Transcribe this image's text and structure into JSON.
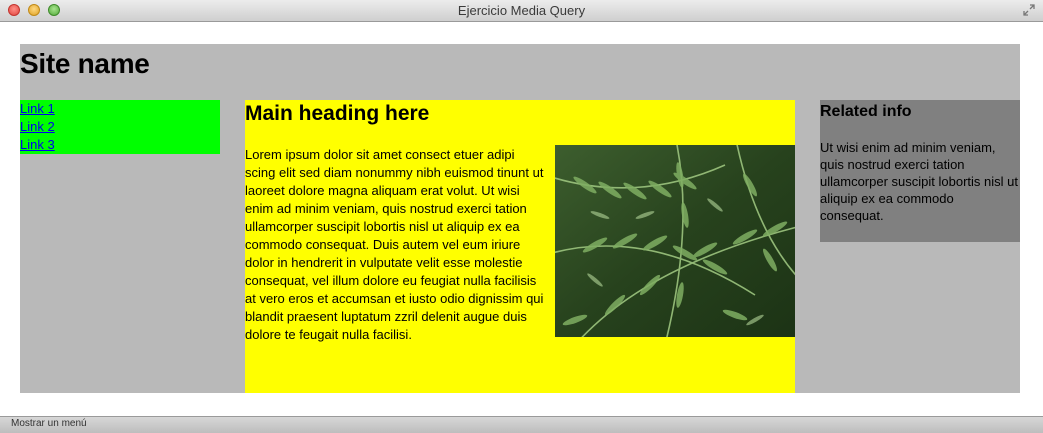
{
  "window": {
    "title": "Ejercicio Media Query"
  },
  "header": {
    "site_name": "Site name"
  },
  "nav": {
    "links": [
      "Link 1",
      "Link 2",
      "Link 3"
    ]
  },
  "main": {
    "heading": "Main heading here",
    "body": "Lorem ipsum dolor sit amet consect etuer adipi scing elit sed diam nonummy nibh euismod tinunt ut laoreet dolore magna aliquam erat volut. Ut wisi enim ad minim veniam, quis nostrud exerci tation ullamcorper suscipit lobortis nisl ut aliquip ex ea commodo consequat. Duis autem vel eum iriure dolor in hendrerit in vulputate velit esse molestie consequat, vel illum dolore eu feugiat nulla facilisis at vero eros et accumsan et iusto odio dignissim qui blandit praesent luptatum zzril delenit augue duis dolore te feugait nulla facilisi.",
    "image_icon": "fern-photo"
  },
  "aside": {
    "heading": "Related info",
    "body": "Ut wisi enim ad minim veniam, quis nostrud exerci tation ullamcorper suscipit lobortis nisl ut aliquip ex ea commodo consequat."
  },
  "statusbar": {
    "text": "Mostrar un menú"
  },
  "colors": {
    "page_bg": "#b9b9b9",
    "nav_bg": "#00ff00",
    "main_bg": "#ffff00",
    "aside_bg": "#808080",
    "link": "#0000ee"
  }
}
